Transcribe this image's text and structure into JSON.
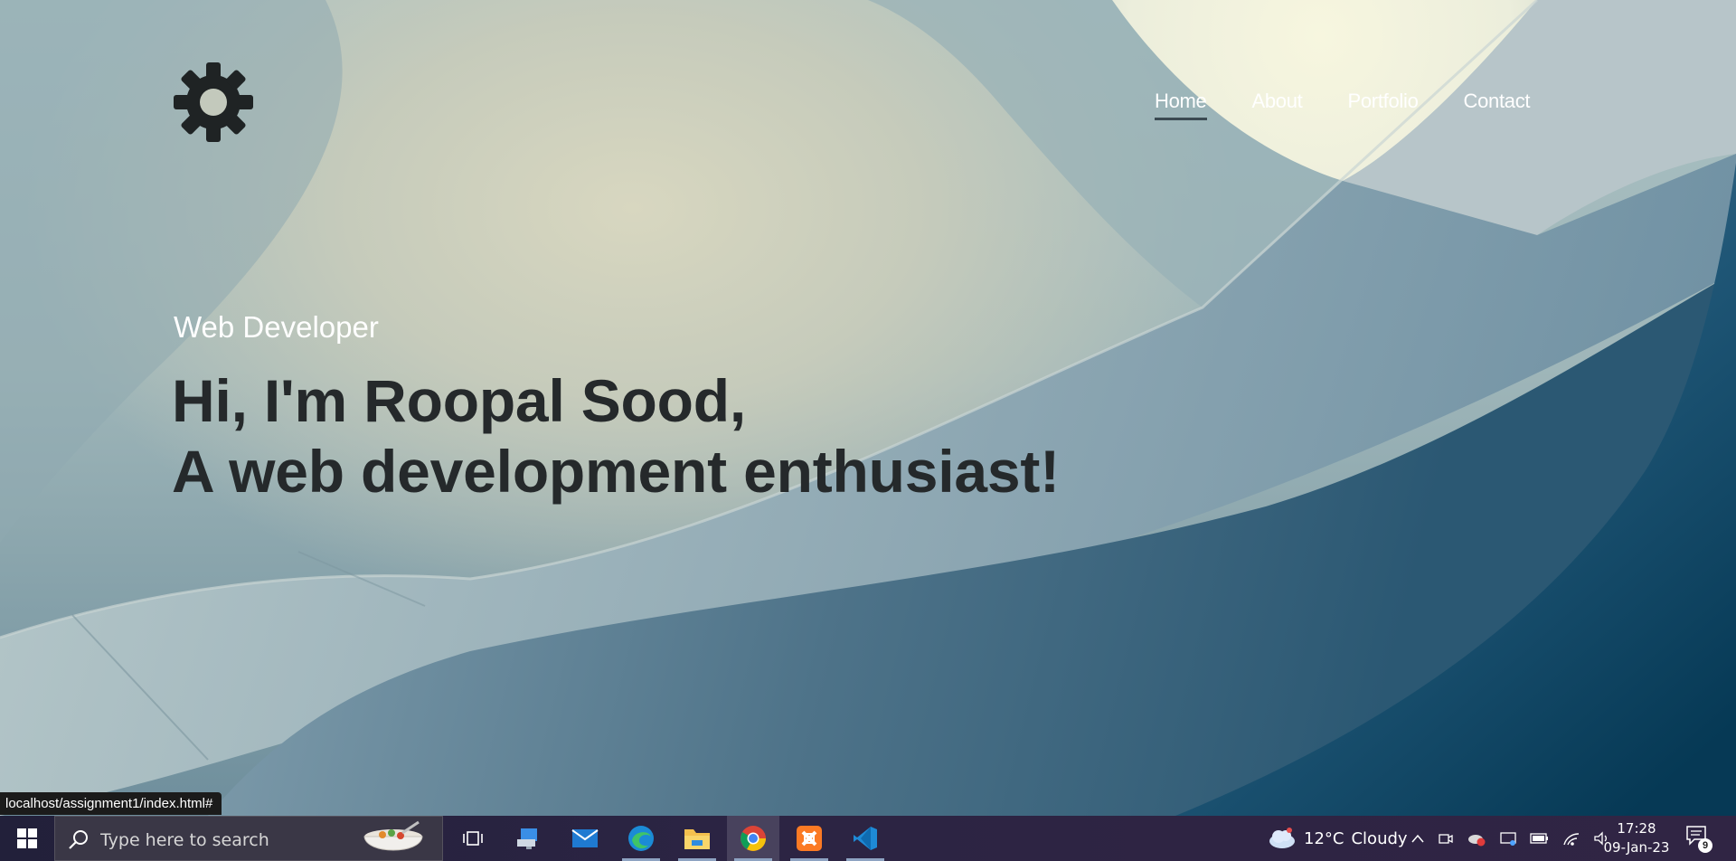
{
  "header": {
    "logo_icon": "gear-icon",
    "nav": [
      {
        "label": "Home",
        "active": true
      },
      {
        "label": "About",
        "active": false
      },
      {
        "label": "Portfolio",
        "active": false
      },
      {
        "label": "Contact",
        "active": false
      }
    ]
  },
  "hero": {
    "subtitle": "Web Developer",
    "headline_line1": "Hi, I'm Roopal Sood,",
    "headline_line2": "A web development enthusiast!"
  },
  "status_bar": {
    "url": "localhost/assignment1/index.html#"
  },
  "taskbar": {
    "search_placeholder": "Type here to search",
    "apps": [
      {
        "name": "task-view-icon"
      },
      {
        "name": "remote-desktop-icon"
      },
      {
        "name": "mail-icon"
      },
      {
        "name": "edge-icon",
        "running": true
      },
      {
        "name": "file-explorer-icon",
        "running": true
      },
      {
        "name": "chrome-icon",
        "running": true,
        "active": true
      },
      {
        "name": "xampp-icon",
        "running": true
      },
      {
        "name": "vscode-icon",
        "running": true
      }
    ],
    "weather": {
      "temp": "12°C",
      "condition": "Cloudy"
    },
    "clock": {
      "time": "17:28",
      "date": "09-Jan-23"
    },
    "notification_count": "9"
  },
  "colors": {
    "headline": "#25292b",
    "nav_text": "#ffffff",
    "taskbar": "#2b2443"
  }
}
